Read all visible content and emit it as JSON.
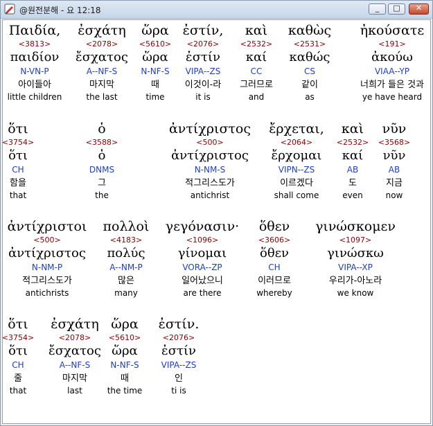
{
  "window": {
    "title": "@원전분해 - 요 12:18",
    "icon": "app-pen-icon",
    "buttons": {
      "minimize": "_",
      "maximize": "□",
      "close": "✕"
    }
  },
  "verse": [
    [
      {
        "greek": "Παιδία,",
        "strong": "<3813>",
        "lemma": "παιδίον",
        "parse": "N-VN-P",
        "korean": "아이들아",
        "english": "little children"
      },
      {
        "greek": "ἐσχάτη",
        "strong": "<2078>",
        "lemma": "ἔσχατος",
        "parse": "A--NF-S",
        "korean": "마지막",
        "english": "the last"
      },
      {
        "greek": "ὥρα",
        "strong": "<5610>",
        "lemma": "ὥρα",
        "parse": "N-NF-S",
        "korean": "때",
        "english": "time"
      },
      {
        "greek": "ἐστίν,",
        "strong": "<2076>",
        "lemma": "ἐστίν",
        "parse": "VIPA--ZS",
        "korean": "이것이-라",
        "english": "it is"
      },
      {
        "greek": "καὶ",
        "strong": "<2532>",
        "lemma": "καί",
        "parse": "CC",
        "korean": "그러므로",
        "english": "and"
      },
      {
        "greek": "καθὼς",
        "strong": "<2531>",
        "lemma": "καθώς",
        "parse": "CS",
        "korean": "같이",
        "english": "as"
      },
      {
        "greek": "ἠκούσατε",
        "strong": "<191>",
        "lemma": "ἀκούω",
        "parse": "VIAA--YP",
        "korean": "너희가 들은 것과",
        "english": "ye have heard"
      }
    ],
    [
      {
        "greek": "ὅτι",
        "strong": "<3754>",
        "lemma": "ὅτι",
        "parse": "CH",
        "korean": "함을",
        "english": "that"
      },
      {
        "greek": "ὁ",
        "strong": "<3588>",
        "lemma": "ὁ",
        "parse": "DNMS",
        "korean": "그",
        "english": "the"
      },
      {
        "greek": "ἀντίχριστος",
        "strong": "<500>",
        "lemma": "ἀντίχριστος",
        "parse": "N-NM-S",
        "korean": "적그리스도가",
        "english": "antichrist"
      },
      {
        "greek": "ἔρχεται,",
        "strong": "<2064>",
        "lemma": "ἔρχομαι",
        "parse": "VIPN--ZS",
        "korean": "이르겠다",
        "english": "shall come"
      },
      {
        "greek": "καὶ",
        "strong": "<2532>",
        "lemma": "καί",
        "parse": "AB",
        "korean": "도",
        "english": "even"
      },
      {
        "greek": "νῦν",
        "strong": "<3568>",
        "lemma": "νῦν",
        "parse": "AB",
        "korean": "지금",
        "english": "now"
      }
    ],
    [
      {
        "greek": "ἀντίχριστοι",
        "strong": "<500>",
        "lemma": "ἀντίχριστος",
        "parse": "N-NM-P",
        "korean": "적그리스도가",
        "english": "antichrists"
      },
      {
        "greek": "πολλοὶ",
        "strong": "<4183>",
        "lemma": "πολύς",
        "parse": "A--NM-P",
        "korean": "많은",
        "english": "many"
      },
      {
        "greek": "γεγόνασιν·",
        "strong": "<1096>",
        "lemma": "γίνομαι",
        "parse": "VORA--ZP",
        "korean": "일어났으니",
        "english": "are there"
      },
      {
        "greek": "ὅθεν",
        "strong": "<3606>",
        "lemma": "ὅθεν",
        "parse": "CH",
        "korean": "이러므로",
        "english": "whereby"
      },
      {
        "greek": "γινώσκομεν",
        "strong": "<1097>",
        "lemma": "γινώσκω",
        "parse": "VIPA--XP",
        "korean": "우리가-아노라",
        "english": "we know"
      }
    ],
    [
      {
        "greek": "ὅτι",
        "strong": "<3754>",
        "lemma": "ὅτι",
        "parse": "CH",
        "korean": "줄",
        "english": "that"
      },
      {
        "greek": "ἐσχάτη",
        "strong": "<2078>",
        "lemma": "ἔσχατος",
        "parse": "A--NF-S",
        "korean": "마지막",
        "english": "last"
      },
      {
        "greek": "ὥρα",
        "strong": "<5610>",
        "lemma": "ὥρα",
        "parse": "N-NF-S",
        "korean": "때",
        "english": "the time"
      },
      {
        "greek": "ἐστίν.",
        "strong": "<2076>",
        "lemma": "ἐστίν",
        "parse": "VIPA--ZS",
        "korean": "인",
        "english": "ti is"
      }
    ]
  ],
  "colors": {
    "strong": "#8b0000",
    "parse": "#1d3fc4",
    "text": "#000000"
  }
}
